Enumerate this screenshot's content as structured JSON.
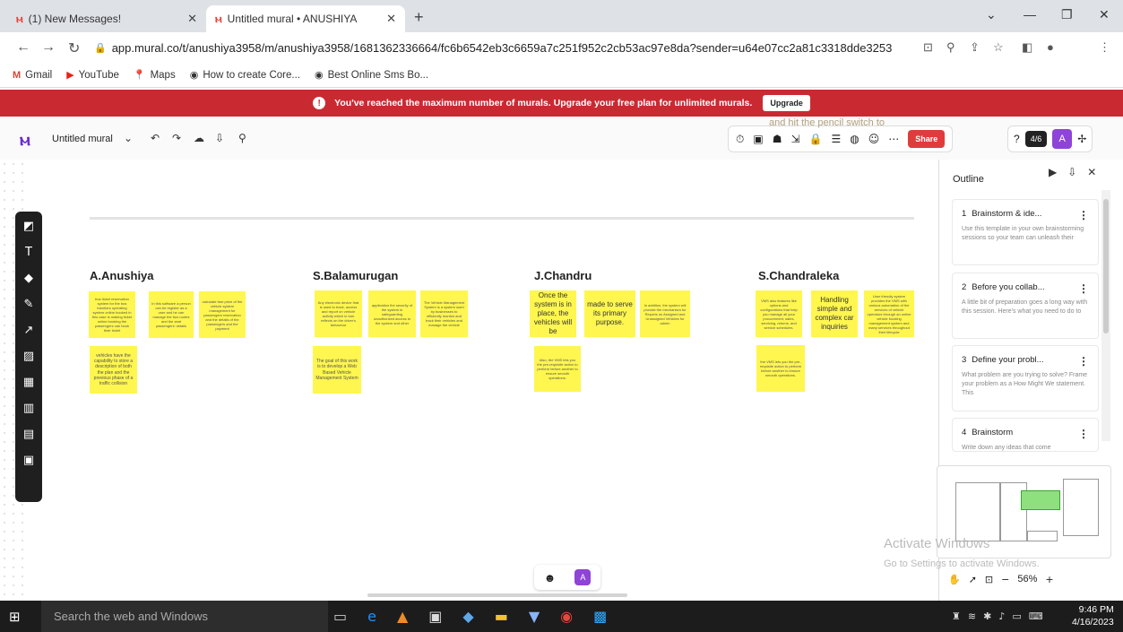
{
  "browser": {
    "tabs": [
      {
        "label": "(1) New Messages!"
      },
      {
        "label": "Untitled mural • ANUSHIYA"
      }
    ],
    "url": "app.mural.co/t/anushiya3958/m/anushiya3958/1681362336664/fc6b6542eb3c6659a7c251f952c2cb53ac97e8da?sender=u64e07cc2a81c3318dde32536",
    "bookmarks": [
      "Gmail",
      "YouTube",
      "Maps",
      "How to create Core...",
      "Best Online Sms Bo..."
    ]
  },
  "banner": {
    "message": "You've reached the maximum number of murals. Upgrade your free plan for unlimited murals.",
    "button": "Upgrade"
  },
  "toolbar": {
    "mural_title": "Untitled mural",
    "share_label": "Share",
    "timer": "4/6",
    "avatar": "A",
    "faded_text": "and hit the pencil switch to"
  },
  "board": {
    "columns": [
      {
        "heading": "A.Anushiya",
        "stickies": [
          "bus ticket reservation system for the bus travelers operating system online booked in this case is making ticket online booking the passengers can book their ticket",
          "In this software a person can be register as a user and he can manage the bus routes and the seat passengers' details",
          "calculate fare price of the vehicle system management for passengers reservation and the details of the passengers and the payment",
          "vehicles have the capability to store a description of both the plan and the previous phase of a traffic collision"
        ]
      },
      {
        "heading": "S.Balamurugan",
        "stickies": [
          "Any electronic device that is used to track, access and report on vehicle activity which in turn reflects on the driver's behaviour",
          "application the security of the system in safeguarding unauthorized access to the system and other",
          "The Vehicle Management System is a system used by businesses to efficiently monitor and track their vehicles and manage the vehicle",
          "The goal of this work is to develop a Web Based Vehicle Management System"
        ]
      },
      {
        "heading": "J.Chandru",
        "stickies": [
          "Once the system is in place, the vehicles will be",
          "made to serve its primary purpose.",
          "In addition, the system will provide the mechanism for Reports on Assigned and Unassigned Vehicles for admin",
          "Also, the VMS lets you the pre-requisite action to perform before another to ensure smooth operations."
        ]
      },
      {
        "heading": "S.Chandraleka",
        "stickies": [
          "VMS also features like options and configurations that help you manage all your procurement, sales, servicing, returns, and service schedules.",
          "Handling simple and complex car inquiries",
          "User friendly system provides the VMS with various automation of the services of vehicle operators through an online vehicle booking management system and many services throughout their lifecycle",
          "the VMS lets you the pre-requisite action to perform before another to ensure smooth operations."
        ]
      }
    ]
  },
  "outline": {
    "title": "Outline",
    "items": [
      {
        "num": "1",
        "title": "Brainstorm & ide...",
        "desc": "Use this template in your own brainstorming sessions so your team can unleash their"
      },
      {
        "num": "2",
        "title": "Before you collab...",
        "desc": "A little bit of preparation goes a long way with this session. Here's what you need to do to"
      },
      {
        "num": "3",
        "title": "Define your probl...",
        "desc": "What problem are you trying to solve? Frame your problem as a How Might We statement. This"
      },
      {
        "num": "4",
        "title": "Brainstorm",
        "desc": "Write down any ideas that come"
      }
    ]
  },
  "zoom": "56%",
  "bottom_avatar": "A",
  "watermark": {
    "line1": "Activate Windows",
    "line2": "Go to Settings to activate Windows."
  },
  "taskbar": {
    "search_placeholder": "Search the web and Windows",
    "time": "9:46 PM",
    "date": "4/16/2023"
  },
  "colors": {
    "banner": "#c92a32",
    "sticky": "#fff64f",
    "brand": "#6a2fcf",
    "share": "#e03c3c"
  }
}
